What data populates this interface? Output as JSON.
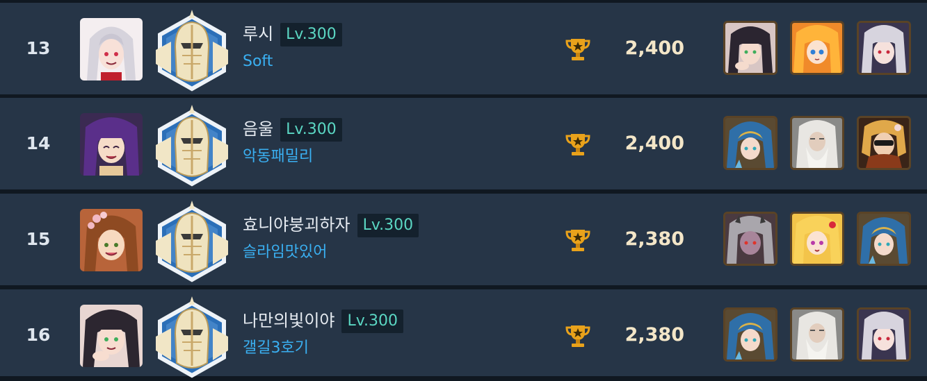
{
  "rows": [
    {
      "rank": "13",
      "name": "루시",
      "level": "Lv.300",
      "guild": "Soft",
      "score": "2,400",
      "portrait": "silver-hair-girl-avatar",
      "heroes": [
        "dark-hair-girl-hero",
        "orange-hair-girl-hero",
        "silver-hair-girl-hero"
      ]
    },
    {
      "rank": "14",
      "name": "음울",
      "level": "Lv.300",
      "guild": "악동패밀리",
      "score": "2,400",
      "portrait": "purple-hair-girl-avatar",
      "heroes": [
        "blue-hood-girl-hero",
        "white-beard-elder-hero",
        "sunglasses-hero"
      ]
    },
    {
      "rank": "15",
      "name": "효니야붕괴하자",
      "level": "Lv.300",
      "guild": "슬라임맛있어",
      "score": "2,380",
      "portrait": "brown-hair-girl-avatar",
      "heroes": [
        "grey-hair-demon-hero",
        "blonde-girl-hero",
        "blue-hood-girl-hero"
      ]
    },
    {
      "rank": "16",
      "name": "나만의빛이야",
      "level": "Lv.300",
      "guild": "갤길3호기",
      "score": "2,380",
      "portrait": "dark-hair-girl-avatar",
      "heroes": [
        "blue-hood-girl-hero",
        "white-beard-elder-hero",
        "silver-hair-girl-hero"
      ]
    }
  ],
  "icons": {
    "emblem": "knight-helmet-emblem-icon",
    "trophy": "trophy-icon"
  },
  "colors": {
    "row_bg": "#263547",
    "separator": "#101821",
    "level_text": "#5bd7c3",
    "guild_text": "#3ab0f2",
    "score_text": "#f3e6c8",
    "trophy": "#e9a21b"
  }
}
